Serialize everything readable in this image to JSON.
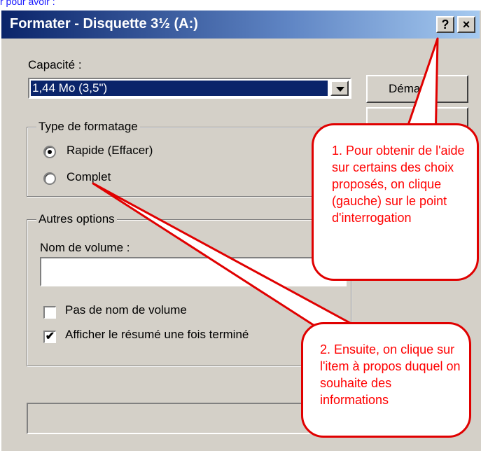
{
  "top_link": "r pour avoir :",
  "window": {
    "title": "Formater - Disquette 3½ (A:)",
    "help_button": "?",
    "close_button": "×"
  },
  "capacity": {
    "label": "Capacité :",
    "value": "1,44 Mo (3,5\")"
  },
  "start_button": "Déma",
  "format_type": {
    "legend": "Type de formatage",
    "options": [
      {
        "label": "Rapide (Effacer)",
        "selected": true
      },
      {
        "label": "Complet",
        "selected": false
      }
    ]
  },
  "other_options": {
    "legend": "Autres options",
    "volume_name_label": "Nom de volume :",
    "volume_name_value": "",
    "checkboxes": [
      {
        "label": "Pas de nom de volume",
        "checked": false
      },
      {
        "label": "Afficher le résumé une fois terminé",
        "checked": true
      }
    ]
  },
  "callouts": [
    {
      "text": "1. Pour obtenir de l'aide sur certains des choix proposés, on clique (gauche) sur le point d'interrogation"
    },
    {
      "text": "2. Ensuite, on clique sur l'item à propos duquel on souhaite des informations"
    }
  ],
  "colors": {
    "callout_border": "#e00000",
    "callout_text": "#ff0000",
    "titlebar_start": "#0a246a",
    "titlebar_end": "#a6caf0"
  }
}
